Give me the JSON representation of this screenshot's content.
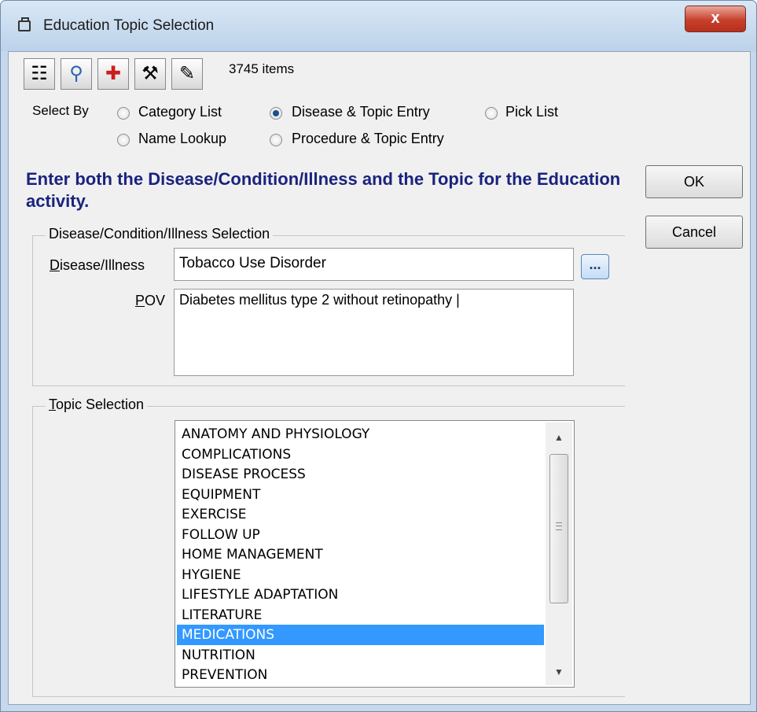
{
  "window": {
    "title": "Education Topic Selection",
    "close_label": "x"
  },
  "toolbar": {
    "buttons": [
      {
        "name": "tree-icon",
        "glyph": "☷"
      },
      {
        "name": "search-icon",
        "glyph": "⚲"
      },
      {
        "name": "add-icon",
        "glyph": "✚"
      },
      {
        "name": "tools-icon",
        "glyph": "⚒"
      },
      {
        "name": "notes-icon",
        "glyph": "✎"
      }
    ],
    "item_count": "3745 items"
  },
  "select_by": {
    "label": "Select By",
    "options": [
      {
        "label": "Category List",
        "selected": false
      },
      {
        "label": "Disease & Topic Entry",
        "selected": true
      },
      {
        "label": "Pick List",
        "selected": false
      },
      {
        "label": "Name Lookup",
        "selected": false
      },
      {
        "label": "Procedure & Topic Entry",
        "selected": false
      }
    ]
  },
  "instruction": "Enter both the Disease/Condition/Illness and the Topic for the Education activity.",
  "buttons": {
    "ok": "OK",
    "cancel": "Cancel"
  },
  "disease_group": {
    "title": "Disease/Condition/Illness Selection",
    "disease_label_first": "D",
    "disease_label_rest": "isease/Illness",
    "disease_value": "Tobacco Use Disorder",
    "ellipsis": "...",
    "pov_label_first": "P",
    "pov_label_rest": "OV",
    "pov_value": "Diabetes mellitus type 2 without retinopathy |"
  },
  "topic_group": {
    "title_first": "T",
    "title_rest": "opic Selection",
    "items": [
      "ANATOMY AND PHYSIOLOGY",
      "COMPLICATIONS",
      "DISEASE PROCESS",
      "EQUIPMENT",
      "EXERCISE",
      "FOLLOW UP",
      "HOME MANAGEMENT",
      "HYGIENE",
      "LIFESTYLE ADAPTATION",
      "LITERATURE",
      "MEDICATIONS",
      "NUTRITION",
      "PREVENTION"
    ],
    "selected": "MEDICATIONS"
  },
  "colors": {
    "accent": "#1a237e",
    "selection": "#3399ff",
    "close": "#c7402c"
  }
}
